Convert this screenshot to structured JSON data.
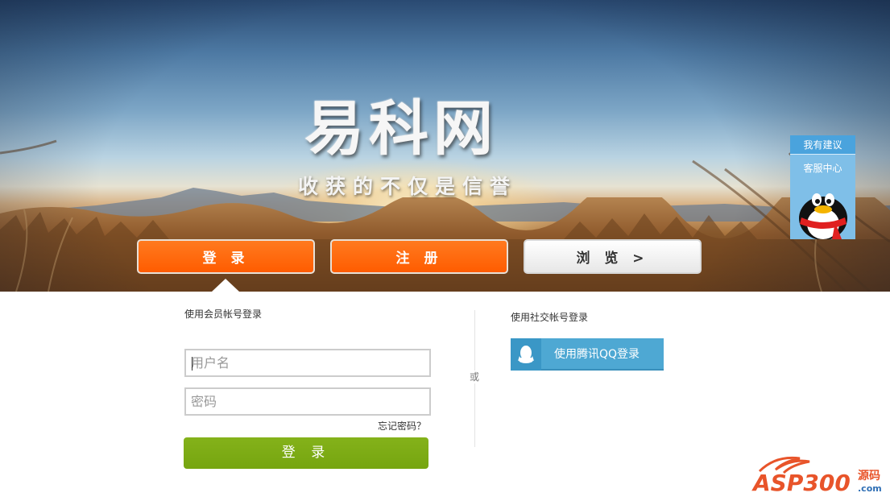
{
  "hero": {
    "brand_title": "易科网",
    "slogan": "收获的不仅是信誉",
    "buttons": {
      "login": "登 录",
      "register": "注 册",
      "browse": "浏 览 >"
    }
  },
  "side_widget": {
    "suggest": "我有建议",
    "service": "客服中心"
  },
  "member_login": {
    "title": "使用会员帐号登录",
    "username_placeholder": "用户名",
    "password_placeholder": "密码",
    "forgot": "忘记密码？",
    "submit": "登 录"
  },
  "divider_text": "或",
  "social_login": {
    "title": "使用社交帐号登录",
    "qq_button": "使用腾讯QQ登录"
  },
  "watermark": {
    "text": "ASP300源码",
    "sub": ".com"
  },
  "colors": {
    "orange_button": "#ff6200",
    "green_submit": "#7cab14",
    "qq_blue": "#4ea8d3",
    "widget_blue": "#4aa3dd"
  }
}
